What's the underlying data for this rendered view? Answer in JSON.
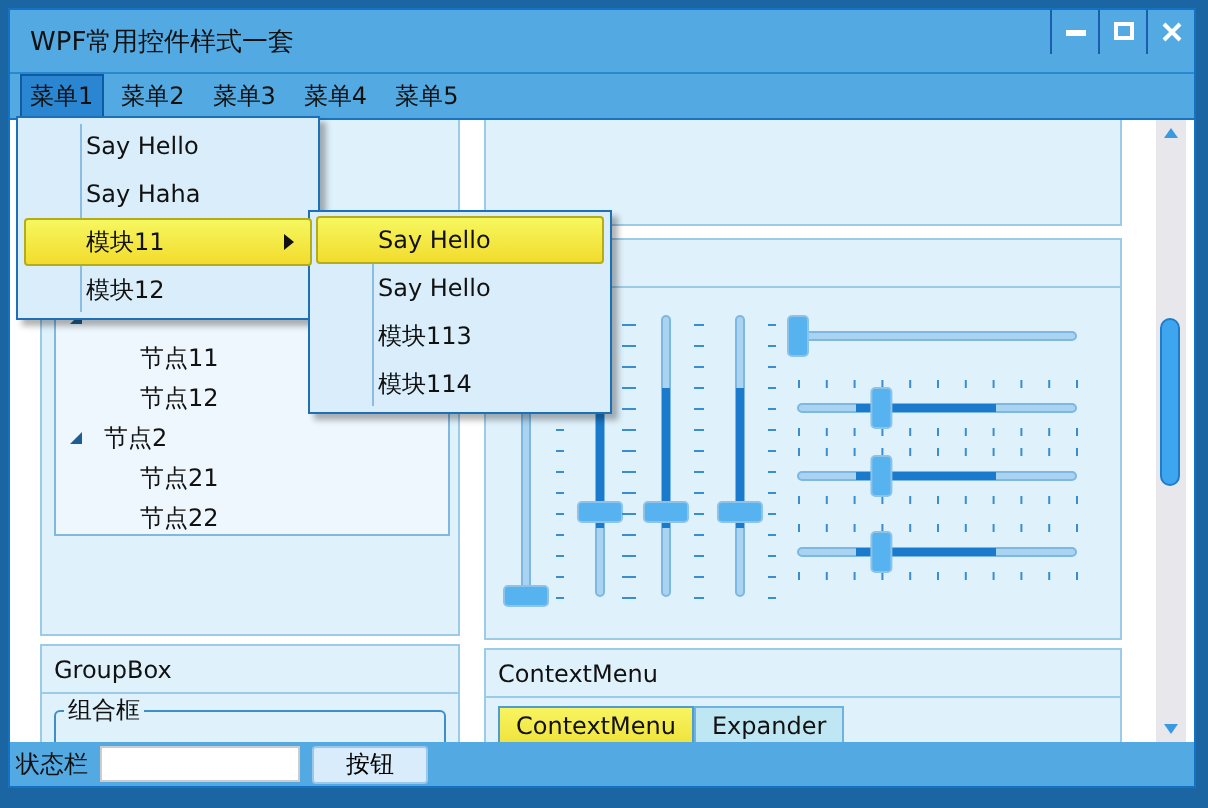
{
  "window": {
    "title": "WPF常用控件样式一套"
  },
  "menu_bar": [
    {
      "label": "菜单1",
      "selected": true
    },
    {
      "label": "菜单2",
      "selected": false
    },
    {
      "label": "菜单3",
      "selected": false
    },
    {
      "label": "菜单4",
      "selected": false
    },
    {
      "label": "菜单5",
      "selected": false
    }
  ],
  "open_menu": [
    {
      "label": "Say Hello",
      "selected": false,
      "submenu": false
    },
    {
      "label": "Say Haha",
      "selected": false,
      "submenu": false
    },
    {
      "label": "模块11",
      "selected": true,
      "submenu": true
    },
    {
      "label": "模块12",
      "selected": false,
      "submenu": false
    }
  ],
  "submenu": [
    {
      "label": "Say Hello",
      "selected": true
    },
    {
      "label": "Say Hello",
      "selected": false
    },
    {
      "label": "模块113",
      "selected": false
    },
    {
      "label": "模块114",
      "selected": false
    }
  ],
  "tree": [
    {
      "expanded": true,
      "children": [
        {
          "label": "节点11"
        },
        {
          "label": "节点12"
        }
      ]
    },
    {
      "label": "节点2",
      "expanded": true,
      "children": [
        {
          "label": "节点21"
        },
        {
          "label": "节点22"
        }
      ]
    }
  ],
  "sliders": [
    {
      "kind": "vertical",
      "level": 0
    },
    {
      "kind": "vertical",
      "level": 0.3
    },
    {
      "kind": "vertical",
      "level": 0.3
    },
    {
      "kind": "vertical",
      "level": 0.3
    },
    {
      "kind": "horizontal",
      "level": 0
    },
    {
      "kind": "horizontal",
      "level": 0.3
    },
    {
      "kind": "horizontal",
      "level": 0.3
    },
    {
      "kind": "horizontal",
      "level": 0.3
    }
  ],
  "groupbox_panel": {
    "title": "GroupBox",
    "group_header": "组合框"
  },
  "context_panel": {
    "title": "ContextMenu",
    "tabs": [
      {
        "label": "ContextMenu",
        "selected": true
      },
      {
        "label": "Expander",
        "selected": false
      }
    ]
  },
  "status_bar": {
    "label": "状态栏",
    "button": "按钮"
  }
}
